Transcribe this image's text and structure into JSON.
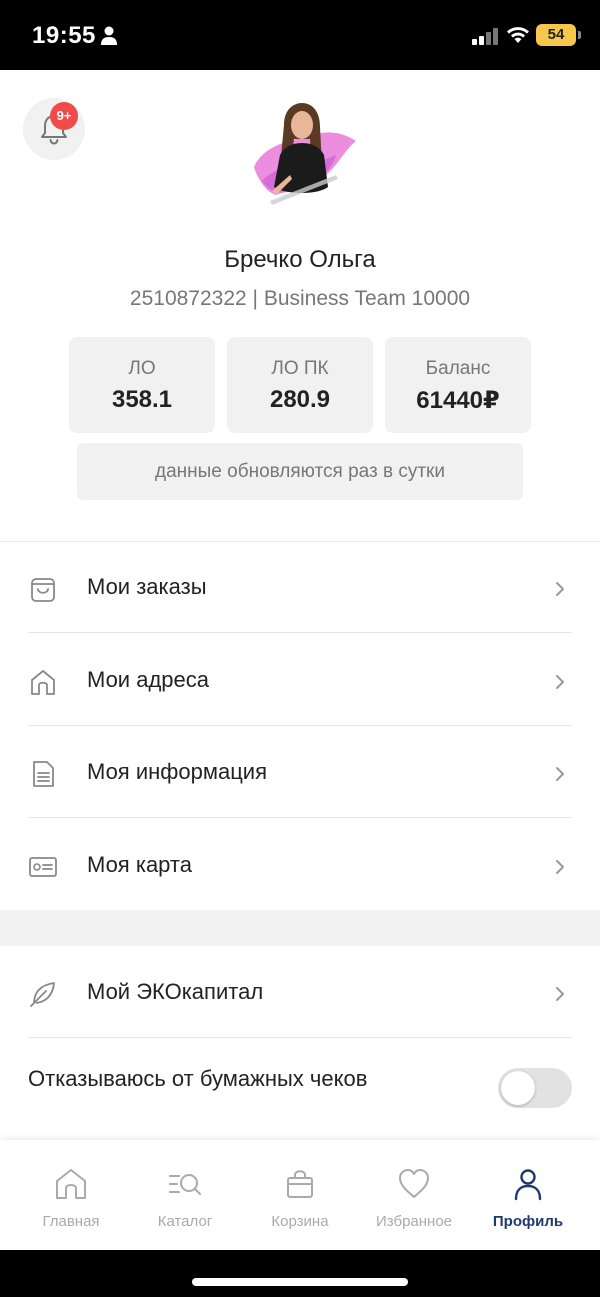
{
  "status_bar": {
    "time": "19:55",
    "battery": "54",
    "icons": [
      "person-icon",
      "signal-icon",
      "wifi-icon",
      "battery-icon"
    ]
  },
  "notifications": {
    "badge": "9+",
    "icon": "bell-icon"
  },
  "profile": {
    "name": "Бречко Ольга",
    "subtitle": "2510872322 | Business Team 10000"
  },
  "stats": [
    {
      "label": "ЛО",
      "value": "358.1"
    },
    {
      "label": "ЛО ПК",
      "value": "280.9"
    },
    {
      "label": "Баланс",
      "value": "61440₽"
    }
  ],
  "update_note": "данные обновляются раз в сутки",
  "menu": [
    {
      "label": "Мои заказы",
      "icon": "bag-icon"
    },
    {
      "label": "Мои адреса",
      "icon": "house-icon"
    },
    {
      "label": "Моя информация",
      "icon": "document-icon"
    },
    {
      "label": "Моя карта",
      "icon": "card-icon"
    }
  ],
  "menu2": [
    {
      "label": "Мой ЭКОкапитал",
      "icon": "leaf-icon"
    }
  ],
  "paper_receipts": {
    "label": "Отказываюсь от бумажных чеков",
    "enabled": false
  },
  "tabs": [
    {
      "label": "Главная",
      "icon": "home-icon",
      "active": false
    },
    {
      "label": "Каталог",
      "icon": "catalog-search-icon",
      "active": false
    },
    {
      "label": "Корзина",
      "icon": "shopping-bag-icon",
      "active": false
    },
    {
      "label": "Избранное",
      "icon": "heart-icon",
      "active": false
    },
    {
      "label": "Профиль",
      "icon": "person-icon",
      "active": true
    }
  ],
  "colors": {
    "accent": "#1e3a6e",
    "badge": "#f04a4a",
    "tile_bg": "#f1f1f1",
    "battery": "#f5c84c"
  }
}
